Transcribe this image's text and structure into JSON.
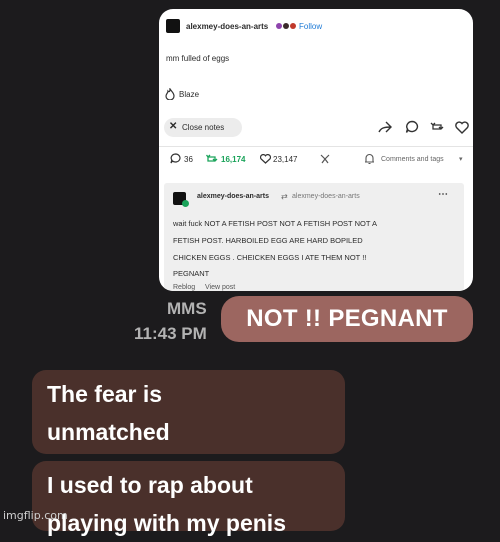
{
  "post": {
    "username": "alexmey-does-an-arts",
    "follow_label": "Follow",
    "body": "mm fulled of eggs",
    "blaze_label": "Blaze",
    "close_notes_label": "Close notes",
    "stats": {
      "replies": "36",
      "reblogs": "16,174",
      "likes": "23,147"
    },
    "comments_tags_label": "Comments and tags",
    "reblog": {
      "username": "alexmey-does-an-arts",
      "reblogged_from": "alexmey-does-an-arts",
      "lines": [
        "wait fuck NOT A FETISH POST NOT A FETISH POST NOT A",
        "FETISH POST. HARBOILED EGG ARE HARD BOPILED",
        "CHICKEN EGGS . CHEICKEN EGGS I ATE THEM NOT !!",
        "PEGNANT"
      ],
      "reblog_label": "Reblog",
      "view_post_label": "View post"
    },
    "colors": {
      "follow": "#1e7ad6",
      "reblog_green": "#1aa35a"
    }
  },
  "message": {
    "type_label": "MMS",
    "time": "11:43 PM",
    "sent_text": "NOT !! PEGNANT",
    "received": [
      {
        "lines": [
          "The fear is",
          "unmatched"
        ]
      },
      {
        "lines": [
          "I used to rap about",
          "playing with my penis"
        ]
      }
    ],
    "colors": {
      "sent": "#9c6660",
      "received": "#4a302b"
    }
  },
  "watermark": "imgflip.com"
}
